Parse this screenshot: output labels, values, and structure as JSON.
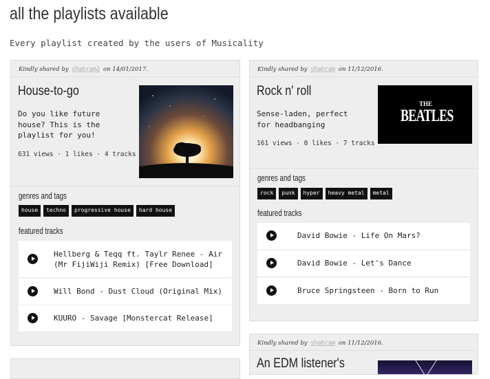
{
  "page": {
    "title": "all the playlists available",
    "subtitle": "Every playlist created by the users of Musicality"
  },
  "labels": {
    "shared_prefix": "Kindly shared by",
    "shared_on": "on",
    "genres": "genres and tags",
    "featured": "featured tracks"
  },
  "playlists": [
    {
      "user": "shahram2",
      "date": "14/01/2017.",
      "title": "House-to-go",
      "description": "Do you like future\nhouse? This is the\nplaylist for you!",
      "stats": "631 views · 1 likes · 4 tracks",
      "image": "sunrise-tree-image",
      "tags": [
        "house",
        "techno",
        "progressive house",
        "hard house"
      ],
      "tracks": [
        "Hellberg & Teqq ft. Taylr Renee - Air (Mr FijiWiji Remix) [Free Download]",
        "Will Bond - Dust Cloud (Original Mix)",
        "KUURO - Savage [Monstercat Release]"
      ]
    },
    {
      "user": "shahram",
      "date": "11/12/2016.",
      "title": "Rock n' roll",
      "description": "Sense-laden, perfect\nfor headbanging",
      "stats": "161 views · 0 likes · 7 tracks",
      "image": "beatles-logo-image",
      "image_text_small": "THE",
      "image_text_large": "BEATLES",
      "tags": [
        "rock",
        "punk",
        "hyper",
        "heavy metal",
        "metal"
      ],
      "tracks": [
        "David Bowie - Life On Mars?",
        "David Bowie - Let's Dance",
        "Bruce Springsteen - Born to Run"
      ]
    },
    {
      "user": "shahram",
      "date": "11/12/2016.",
      "title": "An EDM listener's",
      "image": "edm-light-image"
    }
  ],
  "colors": {
    "card_bg": "#eeeeee",
    "tag_bg": "#111111",
    "track_bg": "#ffffff",
    "username": "#aaaaaa"
  }
}
